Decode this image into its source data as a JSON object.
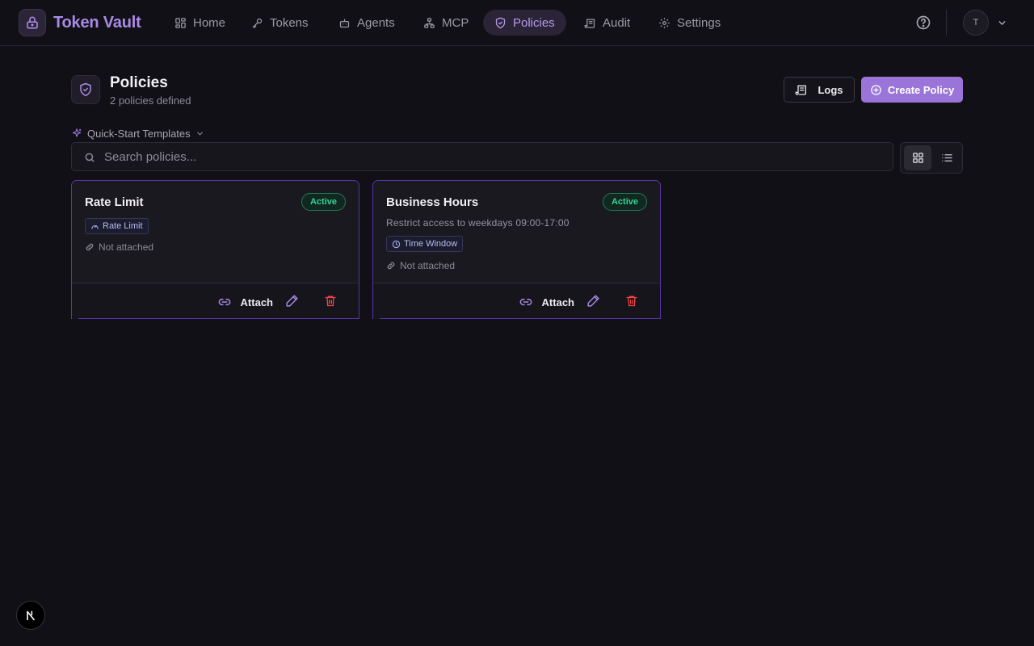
{
  "brand": {
    "name": "Token Vault",
    "icon": "lock-icon"
  },
  "nav": [
    {
      "label": "Home",
      "icon": "grid-icon",
      "active": false
    },
    {
      "label": "Tokens",
      "icon": "key-icon",
      "active": false
    },
    {
      "label": "Agents",
      "icon": "bot-icon",
      "active": false
    },
    {
      "label": "MCP",
      "icon": "network-icon",
      "active": false
    },
    {
      "label": "Policies",
      "icon": "shield-check-icon",
      "active": true
    },
    {
      "label": "Audit",
      "icon": "scroll-icon",
      "active": false
    },
    {
      "label": "Settings",
      "icon": "gear-icon",
      "active": false
    }
  ],
  "user": {
    "initial": "T"
  },
  "header": {
    "title": "Policies",
    "subtitle": "2 policies defined",
    "logs_label": "Logs",
    "create_label": "Create Policy"
  },
  "templates": {
    "label": "Quick-Start Templates"
  },
  "search": {
    "placeholder": "Search policies...",
    "value": ""
  },
  "view": {
    "mode": "grid"
  },
  "policies": [
    {
      "name": "Rate Limit",
      "status": "Active",
      "description": "",
      "type": "Rate Limit",
      "type_icon": "gauge-icon",
      "attachment": "Not attached",
      "attach_label": "Attach"
    },
    {
      "name": "Business Hours",
      "status": "Active",
      "description": "Restrict access to weekdays 09:00-17:00",
      "type": "Time Window",
      "type_icon": "clock-icon",
      "attachment": "Not attached",
      "attach_label": "Attach"
    }
  ],
  "colors": {
    "accent": "#9a74d8",
    "background": "#111016",
    "active_green": "#34d399",
    "danger": "#ef4444"
  }
}
